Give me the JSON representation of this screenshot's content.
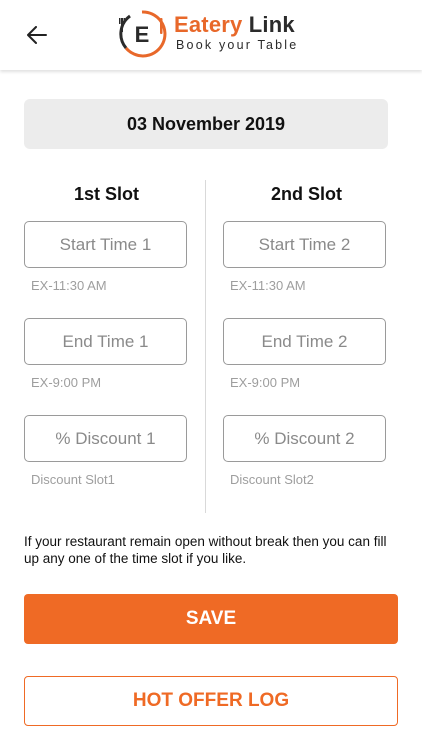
{
  "header": {
    "back_icon": "arrow-left-icon",
    "logo": {
      "title_part1": "Eatery ",
      "title_part2": "Link",
      "tagline": "Book your Table",
      "mark_letter": "E",
      "accent_color": "#e8682a"
    }
  },
  "date": "03 November 2019",
  "slots": {
    "slot1": {
      "title": "1st Slot",
      "start_placeholder": "Start Time 1",
      "start_hint": "EX-11:30 AM",
      "end_placeholder": "End Time 1",
      "end_hint": "EX-9:00 PM",
      "discount_placeholder": "% Discount 1",
      "discount_hint": "Discount Slot1"
    },
    "slot2": {
      "title": "2nd Slot",
      "start_placeholder": "Start Time 2",
      "start_hint": "EX-11:30 AM",
      "end_placeholder": "End Time 2",
      "end_hint": "EX-9:00 PM",
      "discount_placeholder": "% Discount 2",
      "discount_hint": "Discount Slot2"
    }
  },
  "note": "If your restaurant remain open without break then you can fill up any one of the time slot if you like.",
  "buttons": {
    "save": "SAVE",
    "hot_offer_log": "HOT OFFER LOG"
  },
  "colors": {
    "primary": "#ef6a25",
    "date_bg": "#ececec"
  }
}
